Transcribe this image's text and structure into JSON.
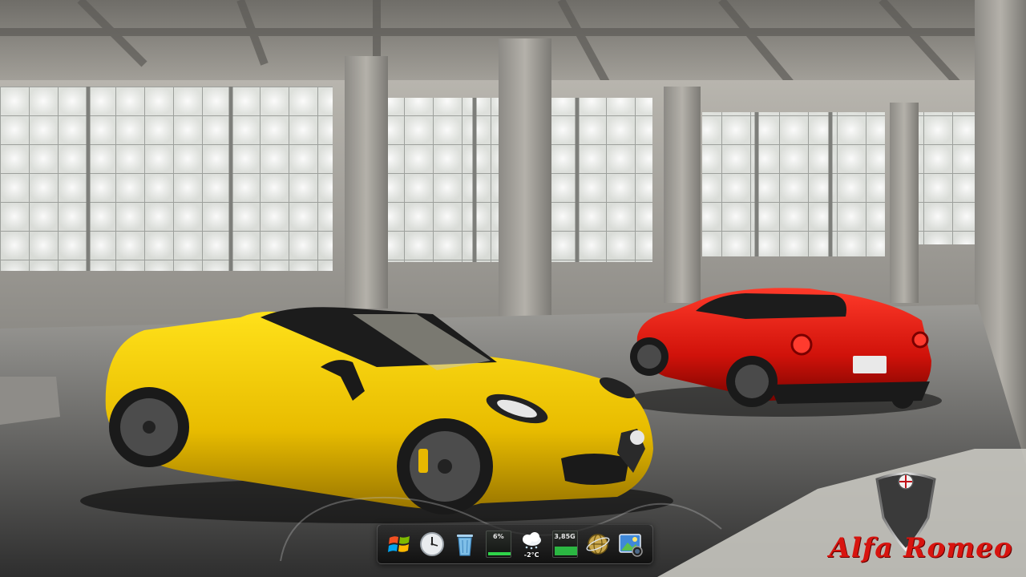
{
  "desktop": {
    "wallpaper_subject": "yellow and red sports cars in a concrete warehouse"
  },
  "brand": {
    "text": "Alfa Romeo",
    "accent_color": "#d8140f"
  },
  "dock": {
    "items": [
      {
        "name": "windows-start-icon"
      },
      {
        "name": "clock-icon"
      },
      {
        "name": "recycle-bin-icon"
      },
      {
        "name": "cpu-meter",
        "label": "6%"
      },
      {
        "name": "weather-gadget",
        "label": "-2°C"
      },
      {
        "name": "memory-meter",
        "label": "3,85G"
      },
      {
        "name": "network-globe-icon"
      },
      {
        "name": "picture-viewer-icon"
      }
    ]
  }
}
